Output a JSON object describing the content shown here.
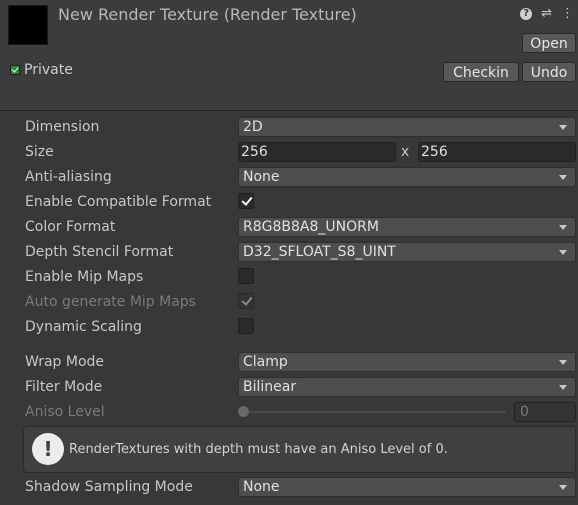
{
  "header": {
    "title": "New Render Texture (Render Texture)",
    "private_label": "Private",
    "private_checked": true,
    "buttons": {
      "open": "Open",
      "checkin": "Checkin",
      "undo": "Undo"
    },
    "icons": [
      "help-icon",
      "presets-icon",
      "kebab-menu-icon"
    ]
  },
  "properties": {
    "dimension": {
      "label": "Dimension",
      "value": "2D"
    },
    "size": {
      "label": "Size",
      "width": "256",
      "separator": "x",
      "height": "256"
    },
    "anti_aliasing": {
      "label": "Anti-aliasing",
      "value": "None"
    },
    "enable_compatible_format": {
      "label": "Enable Compatible Format",
      "checked": true
    },
    "color_format": {
      "label": "Color Format",
      "value": "R8G8B8A8_UNORM"
    },
    "depth_stencil_format": {
      "label": "Depth Stencil Format",
      "value": "D32_SFLOAT_S8_UINT"
    },
    "enable_mip_maps": {
      "label": "Enable Mip Maps",
      "checked": false
    },
    "auto_generate_mip_maps": {
      "label": "Auto generate Mip Maps",
      "checked": true,
      "disabled": true
    },
    "dynamic_scaling": {
      "label": "Dynamic Scaling",
      "checked": false
    },
    "wrap_mode": {
      "label": "Wrap Mode",
      "value": "Clamp"
    },
    "filter_mode": {
      "label": "Filter Mode",
      "value": "Bilinear"
    },
    "aniso_level": {
      "label": "Aniso Level",
      "value": "0",
      "slider_fraction": 0,
      "disabled": true
    },
    "shadow_sampling_mode": {
      "label": "Shadow Sampling Mode",
      "value": "None"
    }
  },
  "info": {
    "icon": "info-icon",
    "message": "RenderTextures with depth must have an Aniso Level of 0."
  }
}
